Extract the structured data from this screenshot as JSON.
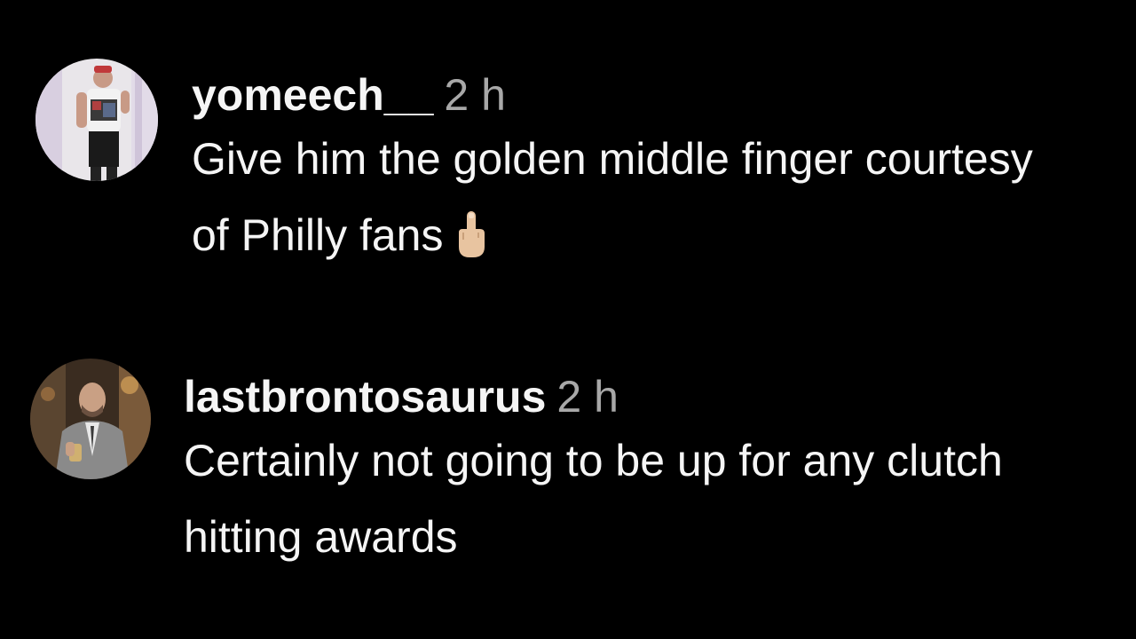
{
  "comments": [
    {
      "username": "yomeech__",
      "timestamp": "2 h",
      "text": "Give him the golden middle finger courtesy of Philly fans",
      "emoji": "middle-finger-icon",
      "avatar": "user-avatar-standing"
    },
    {
      "username": "lastbrontosaurus",
      "timestamp": "2 h",
      "text": "Certainly not going to be up for any clutch hitting awards",
      "avatar": "user-avatar-suit"
    }
  ],
  "colors": {
    "background": "#000000",
    "text": "#f5f5f5",
    "muted": "#a8a8a8",
    "emoji_skin": "#e8c4a0"
  }
}
